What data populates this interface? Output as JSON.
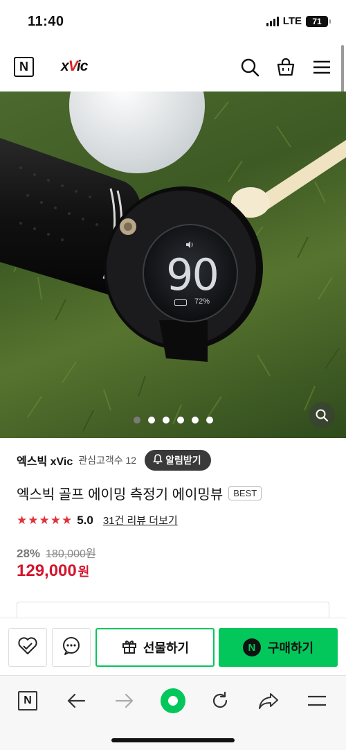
{
  "status_bar": {
    "time": "11:40",
    "network": "LTE",
    "battery": "71"
  },
  "header": {
    "store_badge": "N",
    "logo_prefix": "x",
    "logo_v": "V",
    "logo_suffix": "ic",
    "icons": [
      "search-icon",
      "cart-icon",
      "menu-icon"
    ]
  },
  "hero": {
    "device_display_value": "90",
    "device_battery": "72%",
    "carousel_total": 6,
    "carousel_active": 1
  },
  "seller": {
    "name": "엑스빅 xVic",
    "interest_label": "관심고객수 12",
    "alarm_button": "알림받기"
  },
  "product": {
    "title": "엑스빅 골프 에이밍 측정기 에이밍뷰",
    "badge": "BEST",
    "stars": "★★★★★",
    "rating": "5.0",
    "review_link": "31건 리뷰 더보기",
    "discount": "28%",
    "original_price": "180,000원",
    "sale_price": "129,000",
    "currency": "원"
  },
  "action_bar": {
    "gift_label": "선물하기",
    "buy_label": "구매하기",
    "buy_badge": "N"
  },
  "browser_bar": {
    "home_badge": "N",
    "icons": [
      "home-n-icon",
      "back-arrow-icon",
      "forward-arrow-icon",
      "green-dot-icon",
      "reload-icon",
      "share-icon",
      "menu-icon"
    ]
  },
  "colors": {
    "naver_green": "#03c75a",
    "price_red": "#d5152c",
    "star_red": "#e0323a",
    "logo_red": "#e02020"
  }
}
